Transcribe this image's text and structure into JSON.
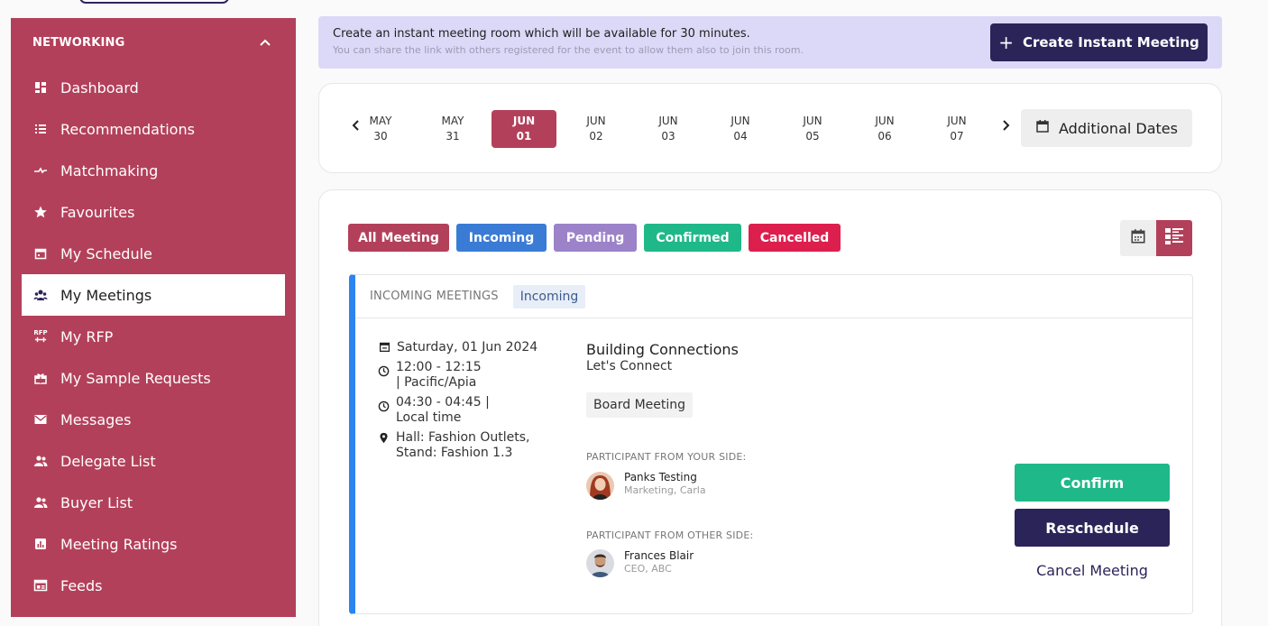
{
  "sidebar": {
    "section_title": "NETWORKING",
    "items": [
      {
        "label": "Dashboard",
        "icon": "dashboard-icon"
      },
      {
        "label": "Recommendations",
        "icon": "list-icon"
      },
      {
        "label": "Matchmaking",
        "icon": "matchmaking-icon"
      },
      {
        "label": "Favourites",
        "icon": "star-icon"
      },
      {
        "label": "My Schedule",
        "icon": "calendar-icon"
      },
      {
        "label": "My Meetings",
        "icon": "group-icon",
        "active": true
      },
      {
        "label": "My RFP",
        "icon": "rfp-icon"
      },
      {
        "label": "My Sample Requests",
        "icon": "gift-icon"
      },
      {
        "label": "Messages",
        "icon": "mail-icon"
      },
      {
        "label": "Delegate List",
        "icon": "people-icon"
      },
      {
        "label": "Buyer List",
        "icon": "people-icon"
      },
      {
        "label": "Meeting Ratings",
        "icon": "chart-icon"
      },
      {
        "label": "Feeds",
        "icon": "feed-icon"
      }
    ]
  },
  "banner": {
    "title": "Create an instant meeting room which will be available for 30 minutes.",
    "subtitle": "You can share the link with others registered for the event to allow them also to join this room.",
    "button_label": "Create Instant Meeting"
  },
  "dates": {
    "items": [
      {
        "month": "MAY",
        "day": "30"
      },
      {
        "month": "MAY",
        "day": "31"
      },
      {
        "month": "JUN",
        "day": "01",
        "selected": true
      },
      {
        "month": "JUN",
        "day": "02"
      },
      {
        "month": "JUN",
        "day": "03"
      },
      {
        "month": "JUN",
        "day": "04"
      },
      {
        "month": "JUN",
        "day": "05"
      },
      {
        "month": "JUN",
        "day": "06"
      },
      {
        "month": "JUN",
        "day": "07"
      }
    ],
    "additional_label": "Additional Dates"
  },
  "filters": [
    {
      "label": "All Meeting",
      "color": "#b3405a"
    },
    {
      "label": "Incoming",
      "color": "#3a7bd5"
    },
    {
      "label": "Pending",
      "color": "#9b82c9"
    },
    {
      "label": "Confirmed",
      "color": "#1fb889"
    },
    {
      "label": "Cancelled",
      "color": "#dd1f4e"
    }
  ],
  "meeting": {
    "section_title": "INCOMING MEETINGS",
    "status_badge": "Incoming",
    "date": "Saturday, 01 Jun 2024",
    "time_event": "12:00 - 12:15 | Pacific/Apia",
    "time_local": "04:30 - 04:45 | Local time",
    "location": "Hall: Fashion Outlets, Stand: Fashion 1.3",
    "title": "Building Connections",
    "subtitle": "Let's Connect",
    "type": "Board Meeting",
    "your_side_label": "PARTICIPANT FROM YOUR SIDE:",
    "your_side": {
      "name": "Panks Testing",
      "role": "Marketing, Carla"
    },
    "other_side_label": "PARTICIPANT FROM OTHER SIDE:",
    "other_side": {
      "name": "Frances Blair",
      "role": "CEO, ABC"
    },
    "confirm_label": "Confirm",
    "reschedule_label": "Reschedule",
    "cancel_label": "Cancel Meeting"
  },
  "colors": {
    "brand": "#b3405a",
    "dark": "#2b2459",
    "accent_blue": "#2b84f0",
    "confirm_green": "#1fb889"
  }
}
